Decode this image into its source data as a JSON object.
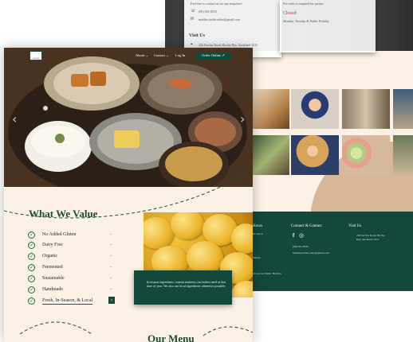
{
  "back": {
    "hero": {
      "feel_free": "Feel free to contact us for any enquiries!",
      "note": "Pre-order is required for parties",
      "phone": "(09) 921-0555",
      "email": "makkie.jardin.order@gmail.com",
      "closed_title": "Closed",
      "closed_days": "Monday, Tuesday & Public Holiday",
      "visit_title": "Visit Us",
      "address": "226 Kevins Road, Birchy Bay, Auckland 1011"
    },
    "footer": {
      "hours_title": "Hours",
      "hours_sub1": "& Lunch",
      "hours_sub2": "Dinner",
      "hours_holiday": "Closed on Public Holiday",
      "contact_title": "Connect & Contact",
      "contact_phone": "(09) 921-0555",
      "contact_email": "makkie.jardin.order@gmail.com",
      "visit_title": "Visit Us",
      "visit_address_1": "226 Kevins Road, Birchy",
      "visit_address_2": "Bay, Auckland 1011"
    }
  },
  "front": {
    "nav": {
      "logo_text": "JARDIN",
      "about": "About ⌄",
      "contact": "Contact ⌄",
      "login": "Log In",
      "order": "Order Online ↗"
    },
    "values": {
      "title": "What We Value",
      "items": [
        {
          "label": "No Added Gluten"
        },
        {
          "label": "Dairy Free"
        },
        {
          "label": "Organic"
        },
        {
          "label": "Fermented"
        },
        {
          "label": "Sustainable"
        },
        {
          "label": "Handmade"
        },
        {
          "label": "Fresh, In-Season, & Local"
        }
      ],
      "callout": "In-season ingredients contain nutrients our bodies need at that time of year. We also use local ingredients whenever possible."
    },
    "menu_title": "Our Menu"
  }
}
